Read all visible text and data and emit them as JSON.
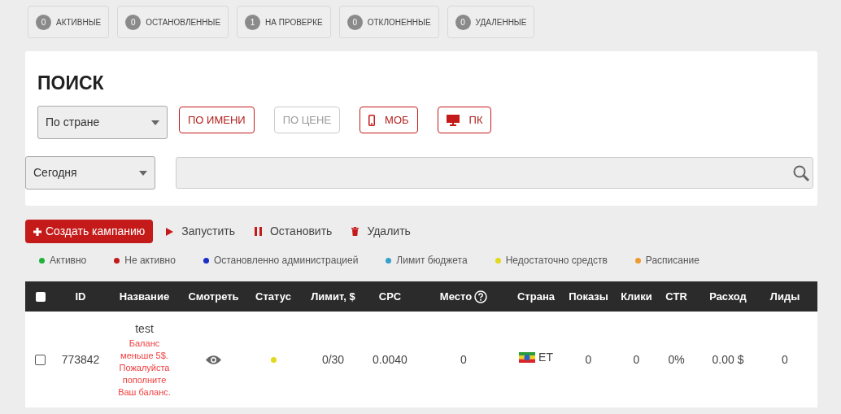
{
  "status_tabs": [
    {
      "count": "0",
      "label": "АКТИВНЫЕ"
    },
    {
      "count": "0",
      "label": "ОСТАНОВЛЕННЫЕ"
    },
    {
      "count": "1",
      "label": "НА ПРОВЕРКЕ"
    },
    {
      "count": "0",
      "label": "ОТКЛОНЕННЫЕ"
    },
    {
      "count": "0",
      "label": "УДАЛЕННЫЕ"
    }
  ],
  "search": {
    "title": "ПОИСК",
    "filter_select": "По стране",
    "filters": [
      {
        "label": "ПО ИМЕНИ",
        "kind": "text",
        "selected": true
      },
      {
        "label": "ПО ЦЕНЕ",
        "kind": "text",
        "selected": false
      },
      {
        "label": "МОБ",
        "kind": "mobile",
        "selected": true
      },
      {
        "label": "ПК",
        "kind": "desktop",
        "selected": true
      }
    ],
    "period_select": "Сегодня"
  },
  "actions": [
    {
      "label": "Создать кампанию",
      "kind": "create"
    },
    {
      "label": "Запустить",
      "kind": "start"
    },
    {
      "label": "Остановить",
      "kind": "stop"
    },
    {
      "label": "Удалить",
      "kind": "delete"
    }
  ],
  "legend": [
    {
      "label": "Активно",
      "color": "#1db33a"
    },
    {
      "label": "Не активно",
      "color": "#c21a1a"
    },
    {
      "label": "Остановленно администрацией",
      "color": "#1a2fc7"
    },
    {
      "label": "Лимит бюджета",
      "color": "#35a0c9"
    },
    {
      "label": "Недостаточно средств",
      "color": "#e0d91c"
    },
    {
      "label": "Расписание",
      "color": "#ee9a2e"
    }
  ],
  "table": {
    "all_checked": false,
    "columns": [
      "ID",
      "Название",
      "Смотреть",
      "Статус",
      "Лимит, $",
      "CPC",
      "Место",
      "Страна",
      "Показы",
      "Клики",
      "CTR",
      "Расход",
      "Лиды"
    ],
    "rows": [
      {
        "checked": false,
        "id": "773842",
        "name": "test",
        "warning": "Баланс меньше 5$. Пожалуйста пополните Ваш баланс.",
        "color": "#e0d91c",
        "limit": "0/30",
        "cpc": "0.0040",
        "place": "0",
        "country": "ET",
        "impressions": "0",
        "clicks": "0",
        "ctr": "0%",
        "spend": "0.00 $",
        "leads": "0"
      }
    ]
  }
}
